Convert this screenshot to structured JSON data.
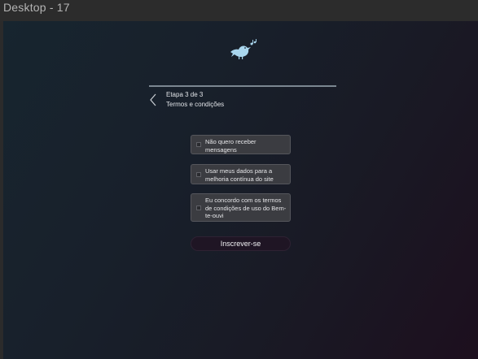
{
  "window": {
    "title": "Desktop - 17"
  },
  "header": {
    "logo_icon": "bird-with-music-notes-icon",
    "logo_color": "#a9d6ee"
  },
  "step": {
    "label": "Etapa 3 de 3",
    "title": "Termos e condições"
  },
  "options": [
    {
      "label": "Não quero receber mensagens",
      "checked": false
    },
    {
      "label": "Usar meus dados para a melhoria contínua do site",
      "checked": false
    },
    {
      "label": "Eu concordo com os termos de condições de uso do Bem-te-ouvi",
      "checked": false
    }
  ],
  "submit": {
    "label": "Inscrever-se"
  },
  "colors": {
    "accent": "#a9d6ee",
    "button_bg": "#1f1524",
    "option_bg": "#3b3c41"
  }
}
